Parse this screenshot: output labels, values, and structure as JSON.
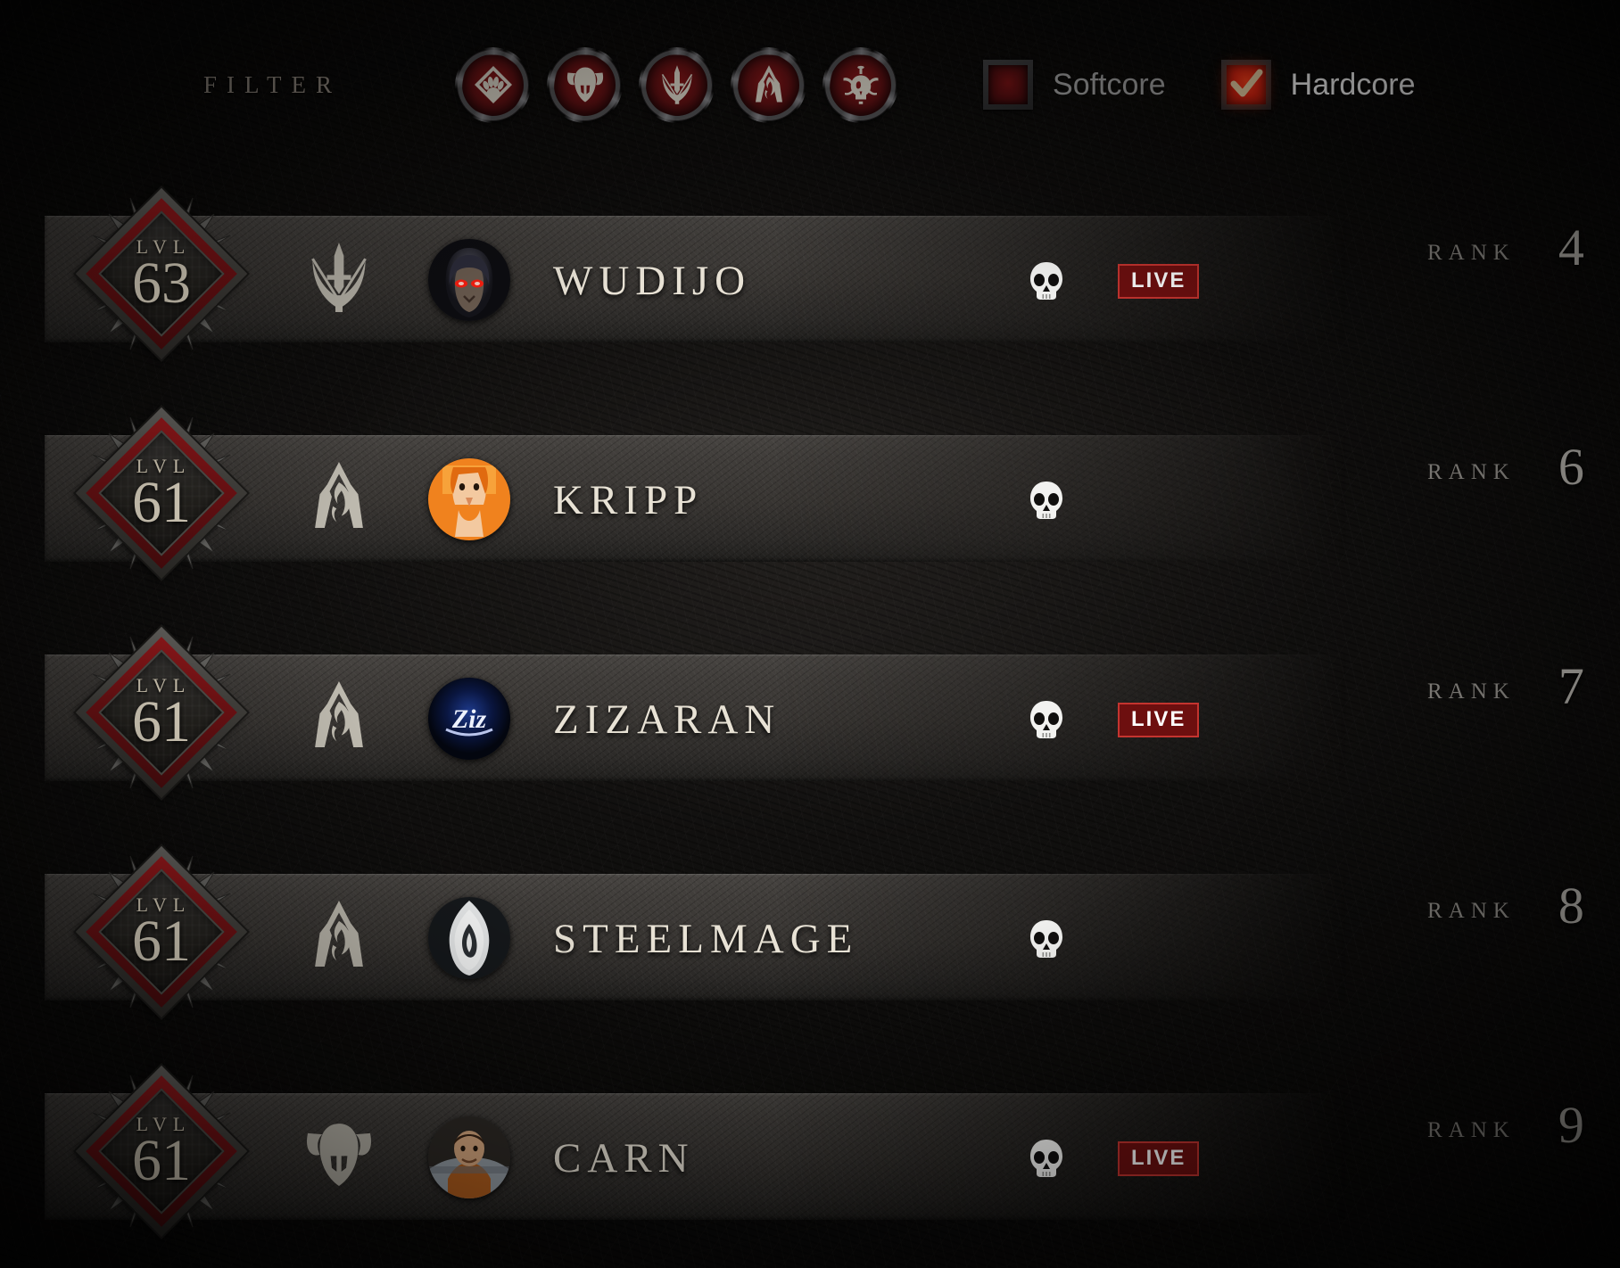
{
  "filter": {
    "label": "FILTER",
    "class_filters": [
      {
        "name": "druid",
        "icon": "druid-class-icon"
      },
      {
        "name": "barbarian",
        "icon": "barbarian-class-icon"
      },
      {
        "name": "rogue",
        "icon": "rogue-class-icon"
      },
      {
        "name": "sorcerer",
        "icon": "sorcerer-class-icon"
      },
      {
        "name": "necromancer",
        "icon": "necromancer-class-icon"
      }
    ],
    "modes": [
      {
        "label": "Softcore",
        "checked": false
      },
      {
        "label": "Hardcore",
        "checked": true
      }
    ]
  },
  "colors": {
    "accent_red": "#8d1408",
    "checked_red": "#d22310",
    "live_bg": "#6d0f0f",
    "live_border": "#c4342f",
    "parchment": "#e8e2d5"
  },
  "labels": {
    "lvl": "LVL",
    "rank": "RANK",
    "live": "LIVE",
    "death_icon": "skull-icon"
  },
  "rows": [
    {
      "level": "63",
      "class": "rogue",
      "class_icon": "rogue-class-icon",
      "avatar": "wudijo-avatar",
      "name": "WUDIJO",
      "dead": true,
      "live": true,
      "rank": "4"
    },
    {
      "level": "61",
      "class": "sorcerer",
      "class_icon": "sorcerer-class-icon",
      "avatar": "kripp-avatar",
      "name": "KRIPP",
      "dead": true,
      "live": false,
      "rank": "6"
    },
    {
      "level": "61",
      "class": "sorcerer",
      "class_icon": "sorcerer-class-icon",
      "avatar": "zizaran-avatar",
      "name": "ZIZARAN",
      "dead": true,
      "live": true,
      "rank": "7"
    },
    {
      "level": "61",
      "class": "sorcerer",
      "class_icon": "sorcerer-class-icon",
      "avatar": "steelmage-avatar",
      "name": "STEELMAGE",
      "dead": true,
      "live": false,
      "rank": "8"
    },
    {
      "level": "61",
      "class": "barbarian",
      "class_icon": "barbarian-class-icon",
      "avatar": "carn-avatar",
      "name": "CARN",
      "dead": true,
      "live": true,
      "rank": "9"
    }
  ]
}
